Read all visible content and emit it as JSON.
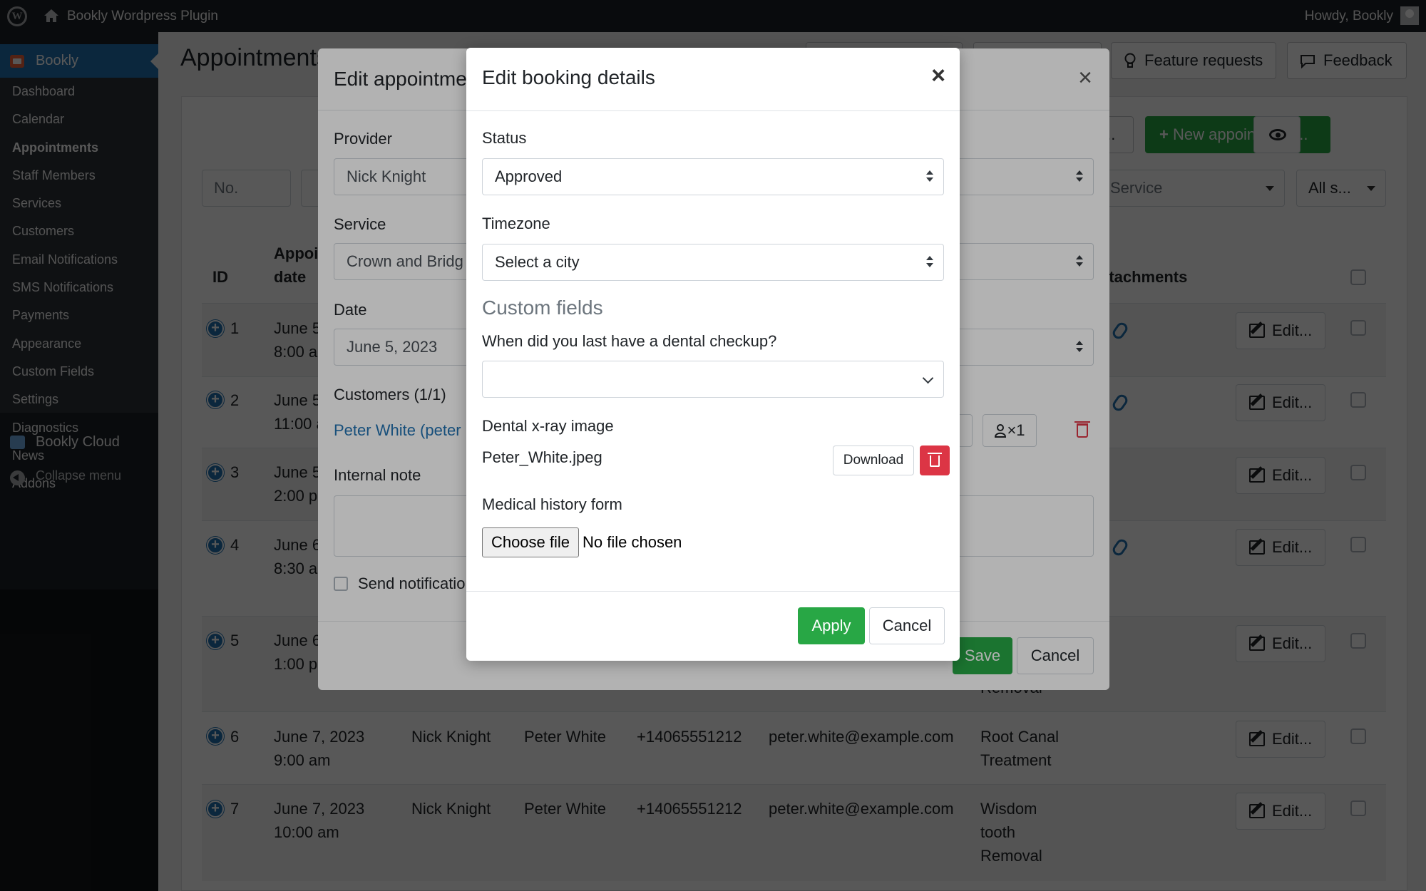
{
  "adminbar": {
    "site_name": "Bookly Wordpress Plugin",
    "howdy": "Howdy, Bookly"
  },
  "sidebar": {
    "title": "Bookly",
    "items": [
      {
        "label": "Dashboard"
      },
      {
        "label": "Calendar"
      },
      {
        "label": "Appointments"
      },
      {
        "label": "Staff Members"
      },
      {
        "label": "Services"
      },
      {
        "label": "Customers"
      },
      {
        "label": "Email Notifications"
      },
      {
        "label": "SMS Notifications"
      },
      {
        "label": "Payments"
      },
      {
        "label": "Appearance"
      },
      {
        "label": "Custom Fields"
      },
      {
        "label": "Settings"
      },
      {
        "label": "Diagnostics"
      },
      {
        "label": "News"
      },
      {
        "label": "Addons"
      }
    ],
    "active": "Appointments",
    "cloud": "Bookly Cloud",
    "collapse": "Collapse menu"
  },
  "page": {
    "title": "Appointments",
    "feature_requests": "Feature requests",
    "feedback": "Feedback",
    "new_appointment": "New appointment...",
    "export_label": "...",
    "filters": {
      "no": "No.",
      "service": "Service",
      "all_status": "All s..."
    }
  },
  "table": {
    "headers": {
      "id": "ID",
      "date_line1": "Appoi",
      "date_line2": "date",
      "attachments": "ttachments"
    },
    "edit_label": "Edit...",
    "rows": [
      {
        "id": "1",
        "date": "June 5",
        "time": "8:00 a"
      },
      {
        "id": "2",
        "date": "June 5",
        "time": "11:00 a"
      },
      {
        "id": "3",
        "date": "June 5",
        "time": "2:00 p"
      },
      {
        "id": "4",
        "date": "June 6",
        "time": "8:30 a"
      },
      {
        "id": "5",
        "date": "June 6",
        "time": "1:00 p",
        "service_tail": "Removal"
      },
      {
        "id": "6",
        "date": "June 7, 2023",
        "time": "9:00 am",
        "provider": "Nick Knight",
        "customer": "Peter White",
        "phone": "+14065551212",
        "email": "peter.white@example.com",
        "service": "Root Canal",
        "service2": "Treatment"
      },
      {
        "id": "7",
        "date": "June 7, 2023",
        "time": "10:00 am",
        "provider": "Nick Knight",
        "customer": "Peter White",
        "phone": "+14065551212",
        "email": "peter.white@example.com",
        "service": "Wisdom",
        "service2": "tooth",
        "service3": "Removal"
      }
    ]
  },
  "edit_appointment": {
    "title": "Edit appointme",
    "provider_label": "Provider",
    "provider_value": "Nick Knight",
    "service_label": "Service",
    "service_value": "Crown and Bridg",
    "date_label": "Date",
    "date_value": "June 5, 2023",
    "customers_label": "Customers (1/1)",
    "customer_link": "Peter White (peter",
    "customer_count": "×1",
    "internal_note_label": "Internal note",
    "send_notifications": "Send notificatio",
    "save": "Save",
    "cancel": "Cancel"
  },
  "dialog": {
    "title": "Edit booking details",
    "close": "×",
    "status_label": "Status",
    "status_value": "Approved",
    "timezone_label": "Timezone",
    "timezone_value": "Select a city",
    "custom_fields_heading": "Custom fields",
    "question": "When did you last have a dental checkup?",
    "question_value": "",
    "xray_label": "Dental x-ray image",
    "xray_file": "Peter_White.jpeg",
    "download": "Download",
    "medical_label": "Medical history form",
    "choose_file": "Choose file",
    "no_file": "No file chosen",
    "apply": "Apply",
    "cancel": "Cancel"
  },
  "colors": {
    "accent": "#2271b1",
    "success": "#28a745",
    "danger": "#dc3545",
    "admin_dark": "#1d2327"
  }
}
